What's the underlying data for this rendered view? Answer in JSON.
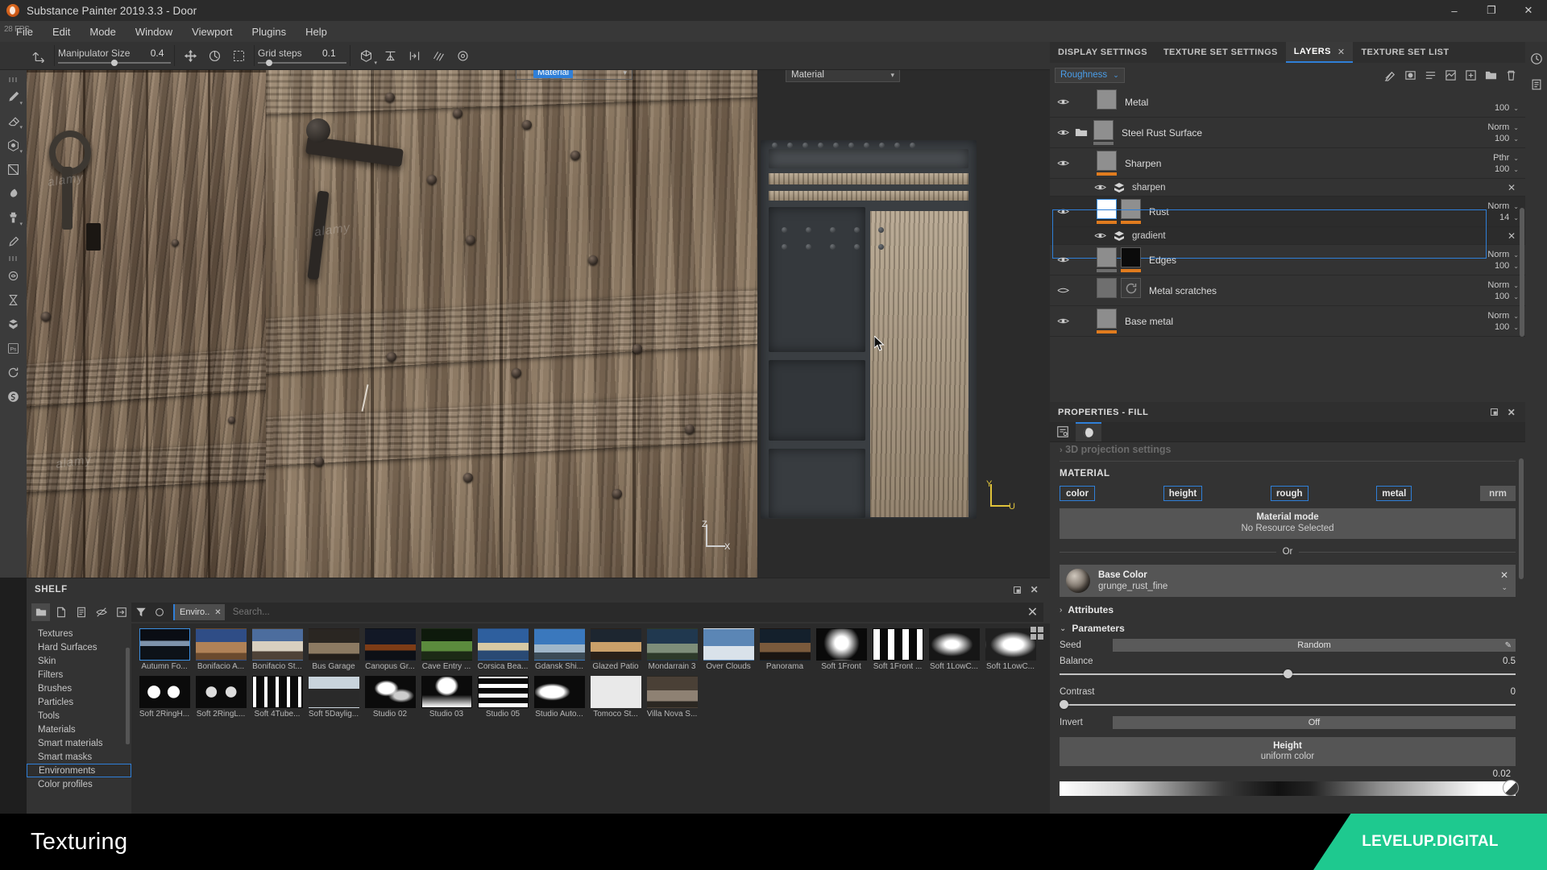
{
  "window": {
    "title": "Substance Painter 2019.3.3 - Door",
    "minimize": "–",
    "maximize": "❐",
    "close": "✕",
    "app_icon": "substance-painter-logo"
  },
  "menu": {
    "fps": "28 FPS",
    "items": [
      "File",
      "Edit",
      "Mode",
      "Window",
      "Viewport",
      "Plugins",
      "Help"
    ]
  },
  "toolbar": {
    "manipulator_label": "Manipulator Size",
    "manipulator_value": "0.4",
    "grid_label": "Grid steps",
    "grid_value": "0.1",
    "icons": [
      "transform-tool-icon",
      "move-tool-icon",
      "rotate-tool-icon",
      "scale-tool-icon",
      "cube-view-icon",
      "symmetry-icon",
      "mirror-icon",
      "quick-mask-icon",
      "settings-gear-icon"
    ],
    "right_icons": [
      "texture-display-icon",
      "render-mesh-icon",
      "camera-view-icon",
      "screenshot-icon"
    ]
  },
  "left_rail": {
    "icons": [
      "paint-brush-icon",
      "eraser-icon",
      "projection-icon",
      "polygon-fill-icon",
      "smudge-icon",
      "clone-stamp-icon",
      "eyedropper-icon",
      "material-particle-icon",
      "physical-paint-icon",
      "substance-effect-icon",
      "photoshop-icon",
      "refresh-icon",
      "substance-source-icon"
    ]
  },
  "viewport": {
    "material_badge": "Material",
    "badge_dropdown_caret": "⌄",
    "material_dropdown": "Material",
    "axis_3d": [
      "Z",
      "X"
    ],
    "axis_uv": [
      "Y",
      "U"
    ],
    "watermarks": [
      "alamy",
      "alamy",
      "alamy"
    ]
  },
  "shelf": {
    "title": "SHELF",
    "header_buttons": [
      "restore-panel-icon",
      "close-panel-icon"
    ],
    "tool_icons": [
      "open-folder-icon",
      "new-file-icon",
      "document-icon",
      "hide-icon",
      "import-icon"
    ],
    "filter_icons": [
      "filter-funnel-icon",
      "circle-icon"
    ],
    "filter_tag": "Enviro..",
    "filter_tag_close": "✕",
    "search_placeholder": "Search...",
    "search_clear": "✕",
    "grid_toggle": "grid-view-icon",
    "categories": [
      "Textures",
      "Hard Surfaces",
      "Skin",
      "Filters",
      "Brushes",
      "Particles",
      "Tools",
      "Materials",
      "Smart materials",
      "Smart masks",
      "Environments",
      "Color profiles"
    ],
    "selected_category": "Environments",
    "items_row1": [
      "Autumn Fo...",
      "Bonifacio A...",
      "Bonifacio St...",
      "Bus Garage",
      "Canopus Gr...",
      "Cave Entry ...",
      "Corsica Bea...",
      "Gdansk Shi...",
      "Glazed Patio",
      "Mondarrain 3",
      "Over Clouds",
      "Panorama",
      "Soft 1Front",
      "Soft 1Front ...",
      "Soft 1LowC...",
      "Soft 1LowC..."
    ],
    "items_row2": [
      "Soft 2RingH...",
      "Soft 2RingL...",
      "Soft 4Tube...",
      "Soft 5Daylig...",
      "Studio 02",
      "Studio 03",
      "Studio 05",
      "Studio Auto...",
      "Tomoco St...",
      "Villa Nova S..."
    ],
    "selected_item": "Autumn Fo..."
  },
  "dock": {
    "tabs": [
      {
        "label": "DISPLAY SETTINGS",
        "active": false,
        "closable": false
      },
      {
        "label": "TEXTURE SET SETTINGS",
        "active": false,
        "closable": false
      },
      {
        "label": "LAYERS",
        "active": true,
        "closable": true
      },
      {
        "label": "TEXTURE SET LIST",
        "active": false,
        "closable": false
      }
    ],
    "tab_close": "✕"
  },
  "layers_panel": {
    "channel": "Roughness",
    "channel_caret": "⌄",
    "tool_icons": [
      "add-effect-icon",
      "add-mask-icon",
      "add-fill-layer-icon",
      "add-filter-icon",
      "add-paint-layer-icon",
      "add-folder-icon",
      "delete-layer-icon"
    ],
    "rows": [
      {
        "name": "Metal",
        "kind": "layer",
        "visible": true,
        "blend": "",
        "opacity": "100",
        "thumbs": [
          "checker"
        ],
        "bars": [
          "none"
        ],
        "selected": false,
        "has_folder": false
      },
      {
        "name": "Steel Rust Surface",
        "kind": "folder",
        "visible": true,
        "blend": "Norm",
        "opacity": "100",
        "thumbs": [
          "noise"
        ],
        "bars": [
          "gray"
        ],
        "selected": false,
        "has_folder": true
      },
      {
        "name": "Sharpen",
        "kind": "layer",
        "visible": true,
        "blend": "Pthr",
        "opacity": "100",
        "thumbs": [
          "noise"
        ],
        "bars": [
          "orange"
        ],
        "selected": false,
        "has_folder": false
      },
      {
        "name": "sharpen",
        "kind": "effect",
        "visible": true,
        "blend": "",
        "opacity": "",
        "selected": false,
        "remove": "✕"
      },
      {
        "name": "Rust",
        "kind": "layer",
        "visible": true,
        "blend": "Norm",
        "opacity": "14",
        "thumbs": [
          "white",
          "rust"
        ],
        "bars": [
          "orange",
          "orange"
        ],
        "selected": true,
        "has_folder": false
      },
      {
        "name": "gradient",
        "kind": "effect",
        "visible": true,
        "blend": "",
        "opacity": "",
        "selected": true,
        "remove": "✕"
      },
      {
        "name": "Edges",
        "kind": "layer",
        "visible": true,
        "blend": "Norm",
        "opacity": "100",
        "thumbs": [
          "gray",
          "black"
        ],
        "bars": [
          "gray",
          "orange"
        ],
        "selected": false,
        "has_folder": false
      },
      {
        "name": "Metal scratches",
        "kind": "layer",
        "visible": false,
        "blend": "Norm",
        "opacity": "100",
        "thumbs": [
          "gray",
          "scratch"
        ],
        "bars": [
          "none",
          "none"
        ],
        "selected": false,
        "has_folder": false
      },
      {
        "name": "Base metal",
        "kind": "layer",
        "visible": true,
        "blend": "Norm",
        "opacity": "100",
        "thumbs": [
          "gray"
        ],
        "bars": [
          "orange"
        ],
        "selected": false,
        "has_folder": false
      }
    ],
    "blend_caret": "⌄",
    "opacity_caret": "⌄"
  },
  "properties": {
    "title": "PROPERTIES - FILL",
    "restore": "restore-panel-icon",
    "close": "✕",
    "tabs": [
      "properties-settings-icon",
      "material-sphere-icon"
    ],
    "active_tab_index": 1,
    "ghost_section": "3D projection settings",
    "material_section": "MATERIAL",
    "channels": [
      {
        "label": "color",
        "enabled": true
      },
      {
        "label": "height",
        "enabled": true
      },
      {
        "label": "rough",
        "enabled": true
      },
      {
        "label": "metal",
        "enabled": true
      },
      {
        "label": "nrm",
        "enabled": false
      }
    ],
    "material_mode_title": "Material mode",
    "material_mode_value": "No Resource Selected",
    "or_text": "Or",
    "resource": {
      "title": "Base Color",
      "value": "grunge_rust_fine",
      "clear": "✕",
      "caret": "⌄"
    },
    "attributes_label": "Attributes",
    "attributes_caret": "›",
    "parameters_label": "Parameters",
    "parameters_caret": "⌄",
    "params": [
      {
        "label": "Seed",
        "type": "button",
        "value": "Random",
        "edit_icon": "pencil-icon"
      },
      {
        "label": "Balance",
        "type": "slider",
        "value": "0.5",
        "pct": 50
      },
      {
        "label": "Contrast",
        "type": "slider",
        "value": "0",
        "pct": 0
      },
      {
        "label": "Invert",
        "type": "toggle",
        "value": "Off"
      }
    ],
    "height_title": "Height",
    "height_subtitle": "uniform color",
    "height_value": "0.02"
  },
  "mini_rail": {
    "icons": [
      "history-clock-icon",
      "log-clipboard-icon"
    ]
  },
  "banner": {
    "text": "Texturing",
    "brand": "LEVELUP.DIGITAL",
    "brand_color": "#1ec98f"
  }
}
